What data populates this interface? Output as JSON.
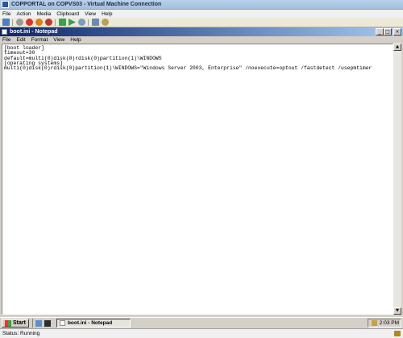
{
  "window": {
    "title": "COPPORTAL on COPVS03 - Virtual Machine Connection",
    "menu": [
      "File",
      "Action",
      "Media",
      "Clipboard",
      "View",
      "Help"
    ]
  },
  "toolbar": {
    "icons": [
      "ctrl-alt-del-icon",
      "turn-off-icon",
      "shutdown-icon",
      "save-icon",
      "pause-icon",
      "start-icon",
      "reset-icon",
      "snapshot-icon",
      "revert-icon"
    ]
  },
  "notepad": {
    "title": "boot.ini - Notepad",
    "menu": [
      "File",
      "Edit",
      "Format",
      "View",
      "Help"
    ],
    "controls": {
      "minimize": "_",
      "maximize": "□",
      "close": "×"
    },
    "content": "[boot loader]\ntimeout=30\ndefault=multi(0)disk(0)rdisk(0)partition(1)\\WINDOWS\n[operating systems]\nmulti(0)disk(0)rdisk(0)partition(1)\\WINDOWS=\"Windows Server 2003, Enterprise\" /noexecute=optout /fastdetect /usepmtimer"
  },
  "taskbar": {
    "start_label": "Start",
    "task_label": "boot.ini - Notepad",
    "clock": "2:03 PM"
  },
  "status": {
    "text": "Status: Running"
  },
  "colors": {
    "vm_titlebar": "#a4bfdd",
    "notepad_titlebar_start": "#0a246a",
    "notepad_titlebar_end": "#a6caf0",
    "classic_gray": "#d4d0c8"
  }
}
